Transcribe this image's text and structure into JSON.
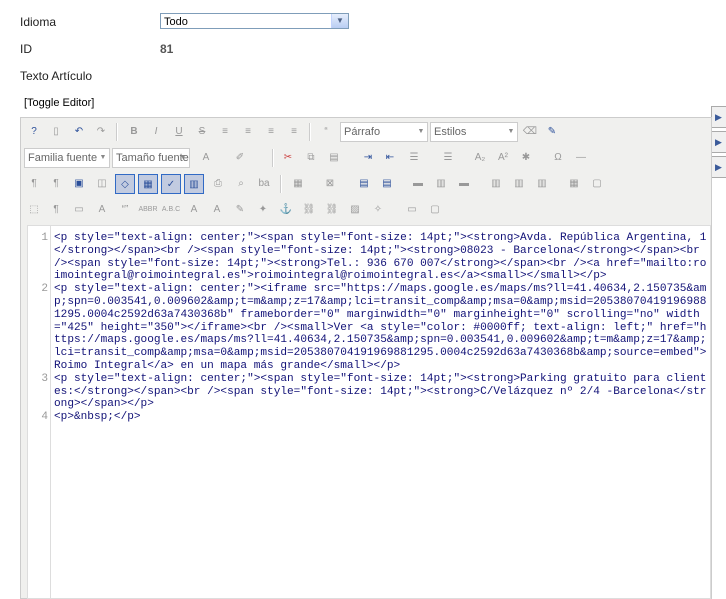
{
  "form": {
    "idioma_label": "Idioma",
    "idioma_value": "Todo",
    "id_label": "ID",
    "id_value": "81",
    "texto_label": "Texto Artículo",
    "toggle_editor": "[Toggle Editor]"
  },
  "toolbar": {
    "row1": {
      "format_select": "Párrafo",
      "styles_select": "Estilos"
    },
    "row2": {
      "font_family_select": "Familia fuente",
      "font_size_select": "Tamaño fuente"
    }
  },
  "code_lines": [
    {
      "num": "1",
      "text": "<p style=\"text-align: center;\"><span style=\"font-size: 14pt;\"><strong>Avda. República Argentina, 1</strong></span><br /><span style=\"font-size: 14pt;\"><strong>08023 - Barcelona</strong></span><br /><span style=\"font-size: 14pt;\"><strong>Tel.: 936 670 007</strong></span><br /><a href=\"mailto:roimointegral@roimointegral.es\">roimointegral@roimointegral.es</a><small></small></p>"
    },
    {
      "num": "2",
      "text": "<p style=\"text-align: center;\"><iframe src=\"https://maps.google.es/maps/ms?ll=41.40634,2.150735&amp;spn=0.003541,0.009602&amp;t=m&amp;z=17&amp;lci=transit_comp&amp;msa=0&amp;msid=205380704191969881295.0004c2592d63a7430368b\" frameborder=\"0\" marginwidth=\"0\" marginheight=\"0\" scrolling=\"no\" width=\"425\" height=\"350\"></iframe><br /><small>Ver <a style=\"color: #0000ff; text-align: left;\" href=\"https://maps.google.es/maps/ms?ll=41.40634,2.150735&amp;spn=0.003541,0.009602&amp;t=m&amp;z=17&amp;lci=transit_comp&amp;msa=0&amp;msid=205380704191969881295.0004c2592d63a7430368b&amp;source=embed\">Roimo Integral</a> en un mapa más grande</small></p>"
    },
    {
      "num": "3",
      "text": "<p style=\"text-align: center;\"><span style=\"font-size: 14pt;\"><strong>Parking gratuito para clientes:</strong></span><br /><span style=\"font-size: 14pt;\"><strong>C/Velázquez nº 2/4 -Barcelona</strong></span></p>"
    },
    {
      "num": "4",
      "text": "<p>&nbsp;</p>"
    }
  ],
  "icons": {
    "row1": [
      "help-icon",
      "new-document-icon",
      "undo-icon",
      "redo-icon",
      "bold-icon",
      "italic-icon",
      "underline-icon",
      "strikethrough-icon",
      "align-justify-icon",
      "align-left-icon",
      "align-center-icon",
      "align-right-icon",
      "blockquote-icon",
      "clear-formatting-icon",
      "paste-format-icon"
    ],
    "row2": [
      "font-color-icon",
      "highlight-color-icon",
      "cut-icon",
      "copy-icon",
      "paste-icon",
      "indent-icon",
      "outdent-icon",
      "bullet-list-icon",
      "numbered-list-icon",
      "subscript-icon",
      "superscript-icon",
      "special-char-icon",
      "omega-icon",
      "horizontal-rule-icon"
    ]
  }
}
